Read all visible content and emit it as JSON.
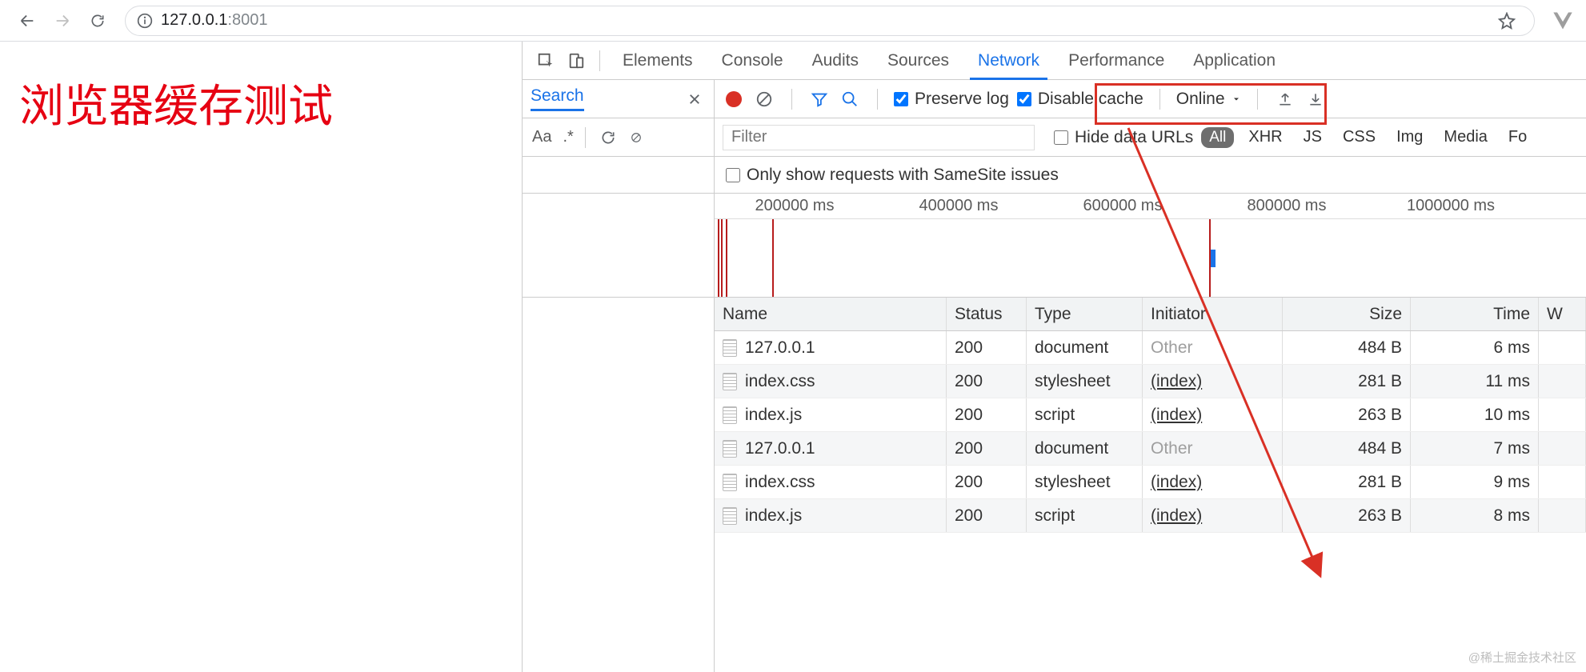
{
  "url": {
    "host": "127.0.0.1",
    "port": ":8001"
  },
  "page": {
    "heading": "浏览器缓存测试"
  },
  "devtools": {
    "tabs": [
      "Elements",
      "Console",
      "Audits",
      "Sources",
      "Network",
      "Performance",
      "Application"
    ],
    "active_tab": "Network",
    "search_label": "Search",
    "preserve_log": "Preserve log",
    "disable_cache": "Disable cache",
    "throttle": "Online",
    "filter_placeholder": "Filter",
    "hide_data_urls": "Hide data URLs",
    "type_pill": "All",
    "types": [
      "XHR",
      "JS",
      "CSS",
      "Img",
      "Media",
      "Fo"
    ],
    "samesite": "Only show requests with SameSite issues",
    "row2_left": {
      "aa": "Aa",
      "regex": ".*"
    },
    "timeline_ticks": [
      "200000 ms",
      "400000 ms",
      "600000 ms",
      "800000 ms",
      "1000000 ms"
    ],
    "columns": {
      "name": "Name",
      "status": "Status",
      "type": "Type",
      "initiator": "Initiator",
      "size": "Size",
      "time": "Time",
      "w": "W"
    },
    "rows": [
      {
        "name": "127.0.0.1",
        "status": "200",
        "type": "document",
        "initiator": "Other",
        "initLink": false,
        "size": "484 B",
        "time": "6 ms"
      },
      {
        "name": "index.css",
        "status": "200",
        "type": "stylesheet",
        "initiator": "(index)",
        "initLink": true,
        "size": "281 B",
        "time": "11 ms"
      },
      {
        "name": "index.js",
        "status": "200",
        "type": "script",
        "initiator": "(index)",
        "initLink": true,
        "size": "263 B",
        "time": "10 ms"
      },
      {
        "name": "127.0.0.1",
        "status": "200",
        "type": "document",
        "initiator": "Other",
        "initLink": false,
        "size": "484 B",
        "time": "7 ms"
      },
      {
        "name": "index.css",
        "status": "200",
        "type": "stylesheet",
        "initiator": "(index)",
        "initLink": true,
        "size": "281 B",
        "time": "9 ms"
      },
      {
        "name": "index.js",
        "status": "200",
        "type": "script",
        "initiator": "(index)",
        "initLink": true,
        "size": "263 B",
        "time": "8 ms"
      }
    ]
  },
  "watermark": "@稀土掘金技术社区"
}
